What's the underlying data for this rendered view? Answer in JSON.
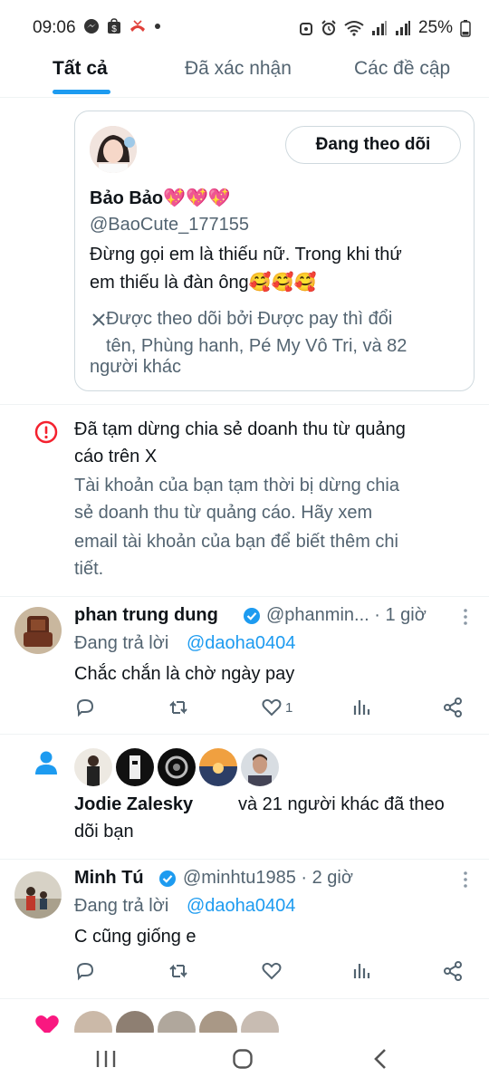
{
  "status_bar": {
    "time": "09:06",
    "battery": "25%"
  },
  "tabs": [
    {
      "label": "Tất cả",
      "active": true
    },
    {
      "label": "Đã xác nhận",
      "active": false
    },
    {
      "label": "Các đề cập",
      "active": false
    }
  ],
  "profile_card": {
    "follow_button": "Đang theo dõi",
    "name": "Bảo Bảo💖💖💖",
    "handle": "@BaoCute_177155",
    "bio_line1": "Đừng gọi em là thiếu nữ. Trong khi thứ",
    "bio_line2": "em thiếu là đàn ông🥰🥰🥰",
    "followed_by_line1": "Được theo dõi bởi Được pay thì đổi",
    "followed_by_line2": "tên, Phùng hanh, Pé My Vô Tri, và 82",
    "followed_by_line3": "người khác"
  },
  "alert": {
    "title_line1": "Đã tạm dừng chia sẻ doanh thu từ quảng",
    "title_line2": "cáo trên X",
    "body_line1": "Tài khoản của bạn tạm thời bị dừng chia",
    "body_line2": "sẻ doanh thu từ quảng cáo. Hãy xem",
    "body_line3": "email tài khoản của bạn để biết thêm chi",
    "body_line4": "tiết."
  },
  "reply1": {
    "name": "phan trung dung",
    "handle_time": "@phanmin... · 1 giờ",
    "replying_prefix": "Đang trả lời",
    "replying_to": "@daoha0404",
    "text": "Chắc chắn là chờ ngày pay",
    "likes": "1"
  },
  "follow_notice": {
    "name": "Jodie Zalesky",
    "line1_rest": "và 21 người khác đã theo",
    "line2": "dõi bạn"
  },
  "reply2": {
    "name": "Minh Tú",
    "handle_time": "@minhtu1985 · 2 giờ",
    "replying_prefix": "Đang trả lời",
    "replying_to": "@daoha0404",
    "text": "C cũng giống e",
    "likes": ""
  },
  "colors": {
    "accent": "#1d9bf0",
    "alert": "#f4212e",
    "like": "#f91880",
    "muted": "#536471"
  },
  "icons": [
    "messenger-icon",
    "shop-icon",
    "missed-call-icon",
    "alarm-icon",
    "wifi-icon",
    "signal-icon",
    "battery-icon",
    "x-logo-icon",
    "alert-icon",
    "verified-icon",
    "more-icon",
    "reply-icon",
    "retweet-icon",
    "like-icon",
    "views-icon",
    "share-icon",
    "person-icon",
    "heart-icon",
    "recents-icon",
    "home-icon",
    "back-icon"
  ]
}
